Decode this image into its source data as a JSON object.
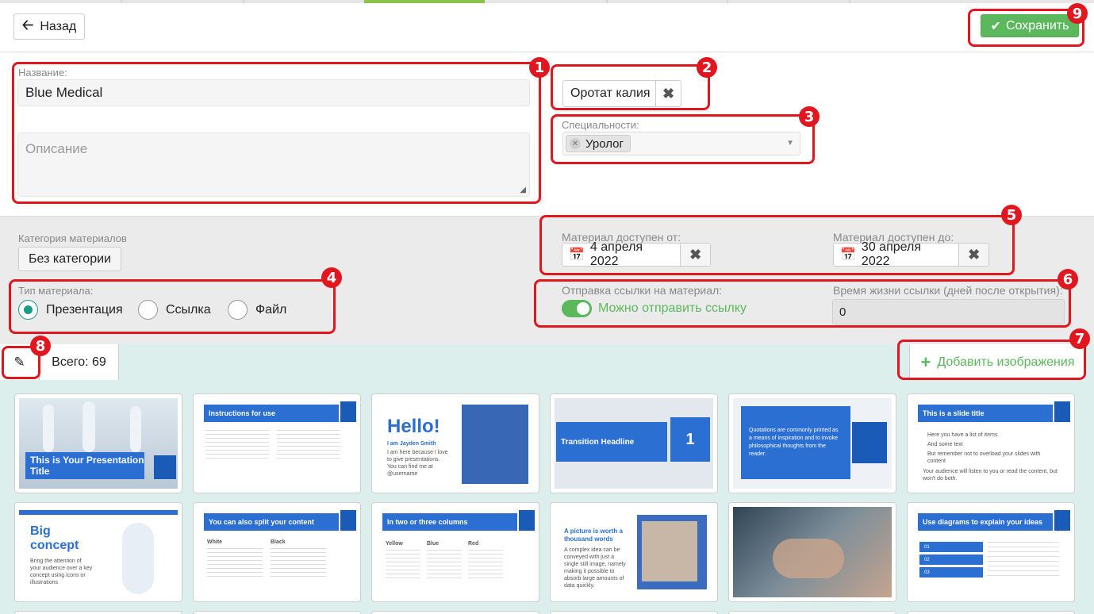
{
  "header": {
    "back_label": "Назад",
    "save_label": "Сохранить"
  },
  "form": {
    "name_label": "Название:",
    "name_value": "Blue Medical",
    "description_placeholder": "Описание",
    "product_tag": "Оротат калия",
    "specialties_label": "Специальности:",
    "specialty_chip": "Уролог"
  },
  "settings": {
    "category_label": "Категория материалов",
    "category_button": "Без категории",
    "material_type_label": "Тип материала:",
    "types": [
      {
        "label": "Презентация",
        "selected": true
      },
      {
        "label": "Ссылка",
        "selected": false
      },
      {
        "label": "Файл",
        "selected": false
      }
    ],
    "available_from_label": "Материал доступен от:",
    "available_from_value": "4 апреля 2022",
    "available_to_label": "Материал доступен до:",
    "available_to_value": "30 апреля 2022",
    "link_send_label": "Отправка ссылки на материал:",
    "link_send_toggle_label": "Можно отправить ссылку",
    "link_send_enabled": true,
    "link_lifetime_label": "Время жизни ссылки (дней после открытия):",
    "link_lifetime_value": "0"
  },
  "gallery": {
    "total_label": "Всего: 69",
    "add_images_label": "Добавить изображения",
    "slides_row1": [
      {
        "title": "This is Your Presentation Title"
      },
      {
        "title": "Instructions for use"
      },
      {
        "title": "Hello!",
        "subtitle": "I am Jayden Smith",
        "body": "I am here because I love to give presentations. You can find me at @username"
      },
      {
        "title": "Transition Headline",
        "number": "1"
      },
      {
        "title": "Quotations are commonly printed as a means of inspiration and to invoke philosophical thoughts from the reader."
      },
      {
        "title": "This is a slide title",
        "bullets": [
          "Here you have a list of items",
          "And some text",
          "But remember not to overload your slides with content"
        ],
        "body": "Your audience will listen to you or read the content, but won't do both."
      }
    ],
    "slides_row2": [
      {
        "title": "Big concept",
        "body": "Bring the attention of your audience over a key concept using icons or illustrations"
      },
      {
        "title": "You can also split your content",
        "col1": "White",
        "col2": "Black"
      },
      {
        "title": "In two or three columns",
        "col1": "Yellow",
        "col2": "Blue",
        "col3": "Red"
      },
      {
        "title": "A picture is worth a thousand words",
        "body": "A complex idea can be conveyed with just a single still image, namely making it possible to absorb large amounts of data quickly."
      },
      {
        "title": ""
      },
      {
        "title": "Use diagrams to explain your ideas",
        "steps": [
          "01",
          "02",
          "03"
        ]
      }
    ]
  },
  "annotations": [
    "1",
    "2",
    "3",
    "4",
    "5",
    "6",
    "7",
    "8",
    "9"
  ],
  "colors": {
    "annotation": "#e2161e",
    "success": "#5cb85c",
    "slide_blue": "#2a6fd1",
    "radio_teal": "#1a9b8a",
    "gallery_bg": "#dcefed"
  }
}
